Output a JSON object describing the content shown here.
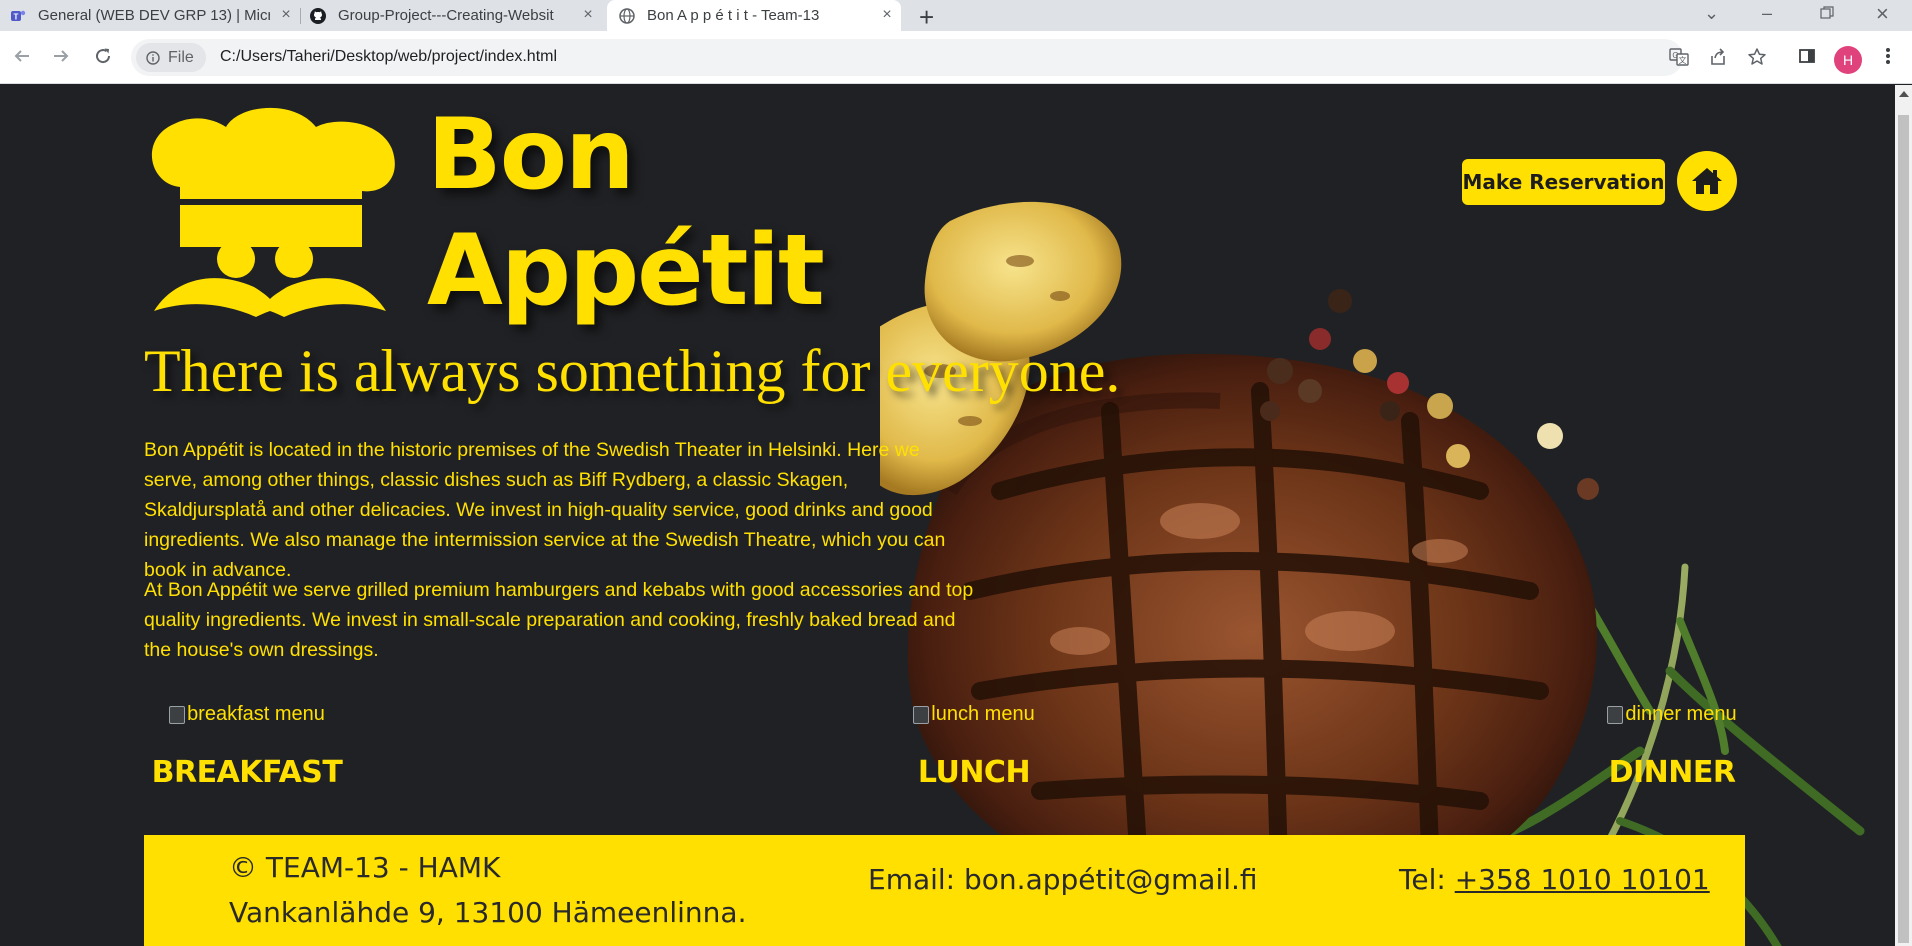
{
  "browser": {
    "tabs": [
      {
        "title": "General (WEB DEV GRP 13) | Micr",
        "icon": "teams-icon"
      },
      {
        "title": "Group-Project---Creating-Websit",
        "icon": "github-icon"
      },
      {
        "title": "Bon A p p é t i t - Team-13",
        "icon": "globe-icon",
        "active": true
      }
    ],
    "new_tab": "+",
    "chip_label": "File",
    "url": "C:/Users/Taheri/Desktop/web/project/index.html",
    "profile_initial": "H"
  },
  "page": {
    "brand_line1": "Bon",
    "brand_line2": "Appétit",
    "reserve_label": "Make Reservation",
    "tagline": "There is always something for everyone.",
    "para1": "Bon Appétit is located in the historic premises of the Swedish Theater in Helsinki. Here we serve, among other things, classic dishes such as Biff Rydberg, a classic Skagen, Skaldjursplatå and other delicacies. We invest in high-quality service, good drinks and good ingredients. We also manage the intermission service at the Swedish Theatre, which you can book in advance.",
    "para2": "At Bon Appétit we serve grilled premium hamburgers and kebabs with good accessories and top quality ingredients. We invest in small-scale preparation and cooking, freshly baked bread and the house's own dressings.",
    "menus": [
      {
        "alt": "breakfast menu",
        "label": "BREAKFAST"
      },
      {
        "alt": "lunch menu",
        "label": "LUNCH"
      },
      {
        "alt": "dinner menu",
        "label": "DINNER"
      }
    ],
    "footer": {
      "copyright": "© TEAM-13 - HAMK",
      "address": "Vankanlähde 9, 13100 Hämeenlinna.",
      "email": "Email: bon.appétit@gmail.fi",
      "tel_label": "Tel: ",
      "tel_number": "+358 1010 10101"
    },
    "colors": {
      "accent": "#ffe000",
      "background": "#202124"
    }
  }
}
